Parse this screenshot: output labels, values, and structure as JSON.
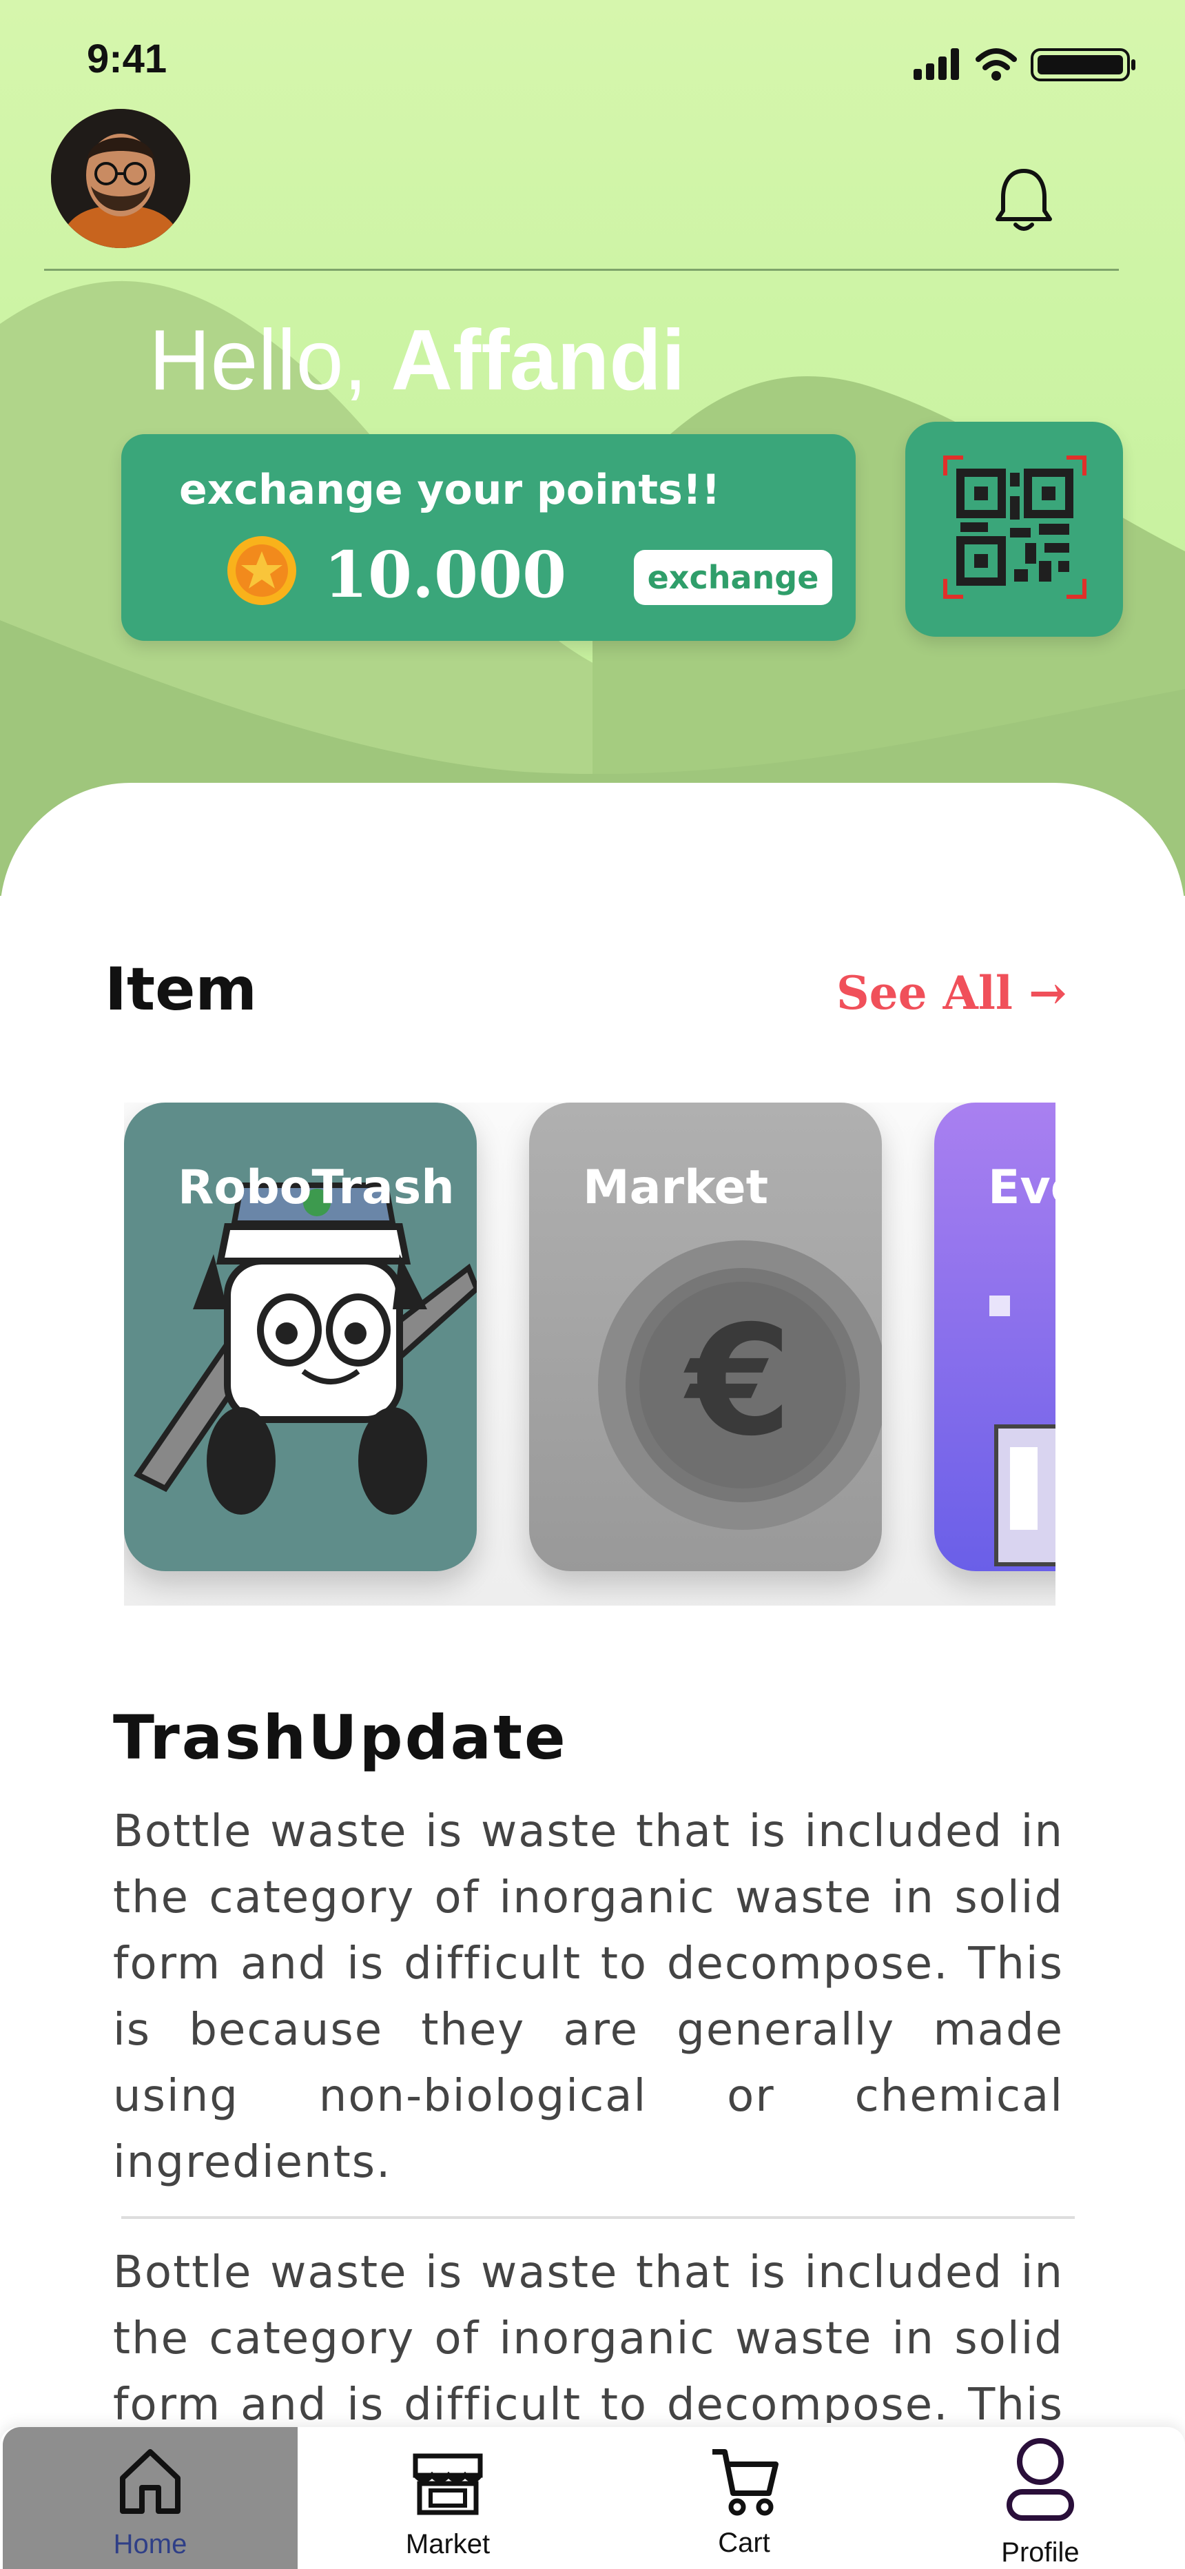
{
  "status_bar": {
    "time": "9:41"
  },
  "header": {
    "greeting_prefix": "Hello,",
    "user_name": "Affandi"
  },
  "points_card": {
    "title": "exchange your points!!",
    "points": "10.000",
    "exchange_label": "exchange"
  },
  "items_section": {
    "title": "Item",
    "see_all_label": "See All →",
    "cards": [
      {
        "label": "RoboTrash"
      },
      {
        "label": "Market"
      },
      {
        "label": "Eve"
      }
    ]
  },
  "news": {
    "title": "TrashUpdate",
    "paragraph_1": "Bottle waste is waste that is included in the category of inorganic waste in solid form and is difficult to decompose. This is because they are generally made using non-biological or chemical ingredients.",
    "paragraph_2": "Bottle waste is waste that is included in the category of inorganic waste in solid form and is difficult to decompose. This is because they are generally made using non-biological or chemical ingredients."
  },
  "tab_bar": {
    "tabs": [
      {
        "label": "Home",
        "icon": "home-icon",
        "active": true
      },
      {
        "label": "Market",
        "icon": "shop-icon",
        "active": false
      },
      {
        "label": "Cart",
        "icon": "cart-icon",
        "active": false
      },
      {
        "label": "Profile",
        "icon": "person-icon",
        "active": false
      }
    ]
  },
  "colors": {
    "hero_background": "#cdf4a5",
    "card_green": "#3aa67a",
    "accent_red": "#f0505a",
    "active_tab": "#8e8e8e",
    "active_tab_label": "#2f3f87"
  }
}
